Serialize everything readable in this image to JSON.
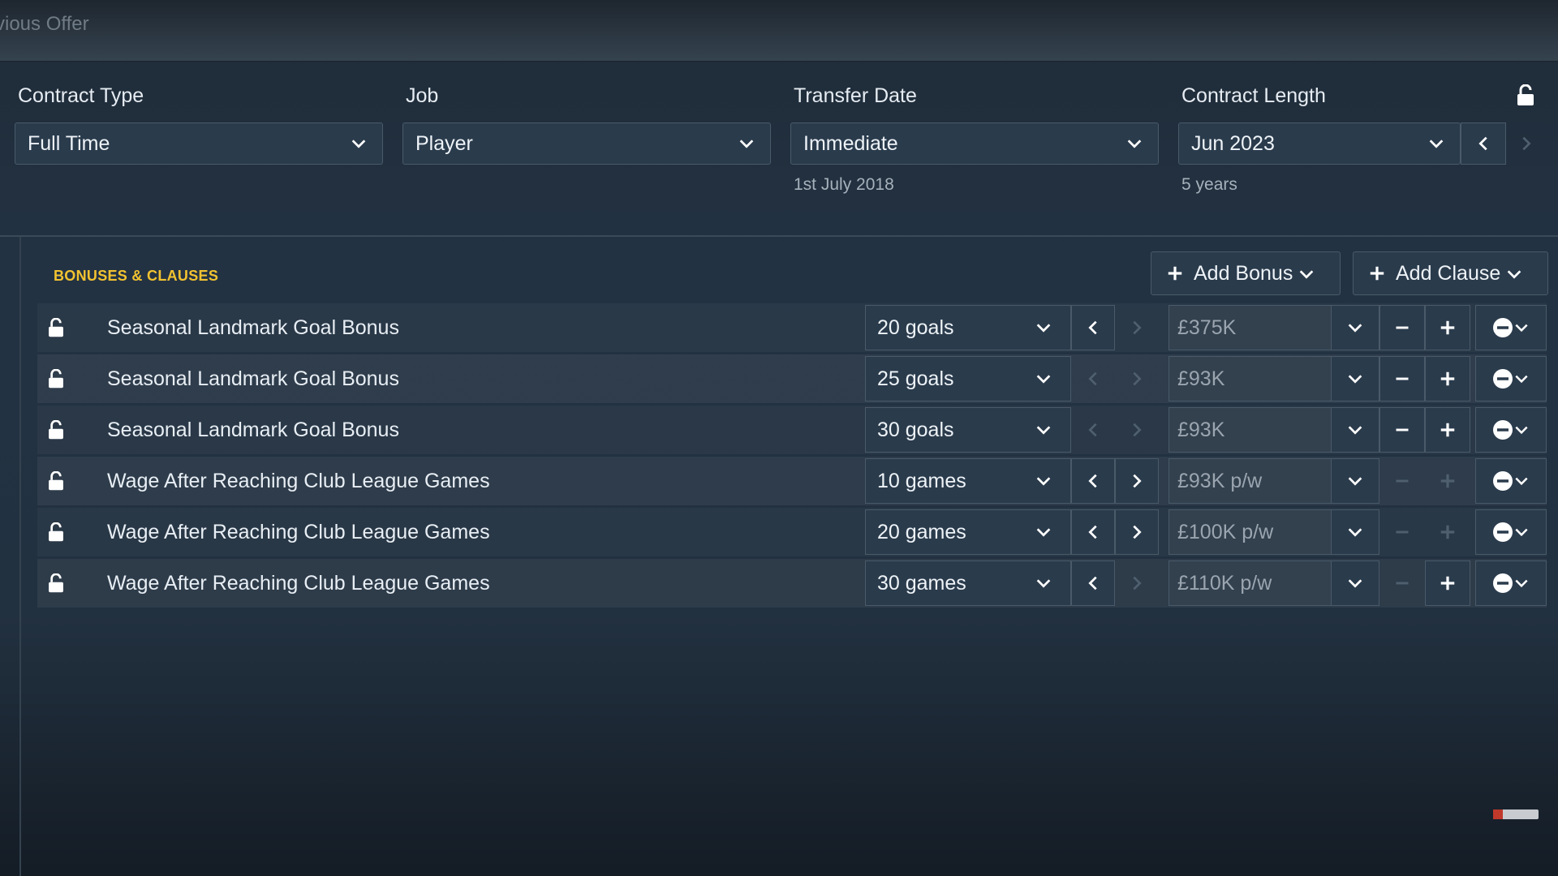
{
  "header": {
    "title": "vious Offer"
  },
  "fields": {
    "contract_type": {
      "label": "Contract Type",
      "value": "Full Time"
    },
    "job": {
      "label": "Job",
      "value": "Player"
    },
    "transfer_date": {
      "label": "Transfer Date",
      "value": "Immediate",
      "note": "1st July 2018"
    },
    "contract_length": {
      "label": "Contract Length",
      "value": "Jun 2023",
      "note": "5 years"
    }
  },
  "bonuses": {
    "section_title": "BONUSES & CLAUSES",
    "add_bonus_label": "Add Bonus",
    "add_clause_label": "Add Clause",
    "rows": [
      {
        "name": "Seasonal Landmark Goal Bonus",
        "threshold": "20 goals",
        "amount": "£375K"
      },
      {
        "name": "Seasonal Landmark Goal Bonus",
        "threshold": "25 goals",
        "amount": "£93K"
      },
      {
        "name": "Seasonal Landmark Goal Bonus",
        "threshold": "30 goals",
        "amount": "£93K"
      },
      {
        "name": "Wage After Reaching Club League Games",
        "threshold": "10 games",
        "amount": "£93K p/w"
      },
      {
        "name": "Wage After Reaching Club League Games",
        "threshold": "20 games",
        "amount": "£100K p/w"
      },
      {
        "name": "Wage After Reaching Club League Games",
        "threshold": "30 games",
        "amount": "£110K p/w"
      }
    ]
  },
  "icons": {
    "lock": "padlock-open-icon",
    "dropdown": "chevron-down-icon",
    "prev": "chevron-left-icon",
    "next": "chevron-right-icon",
    "minus": "minus-icon",
    "plus": "plus-icon",
    "remove": "remove-circle-icon"
  },
  "colors": {
    "accent_yellow": "#f2c230",
    "panel": "#2a3b4c",
    "border": "#4a5a69"
  }
}
